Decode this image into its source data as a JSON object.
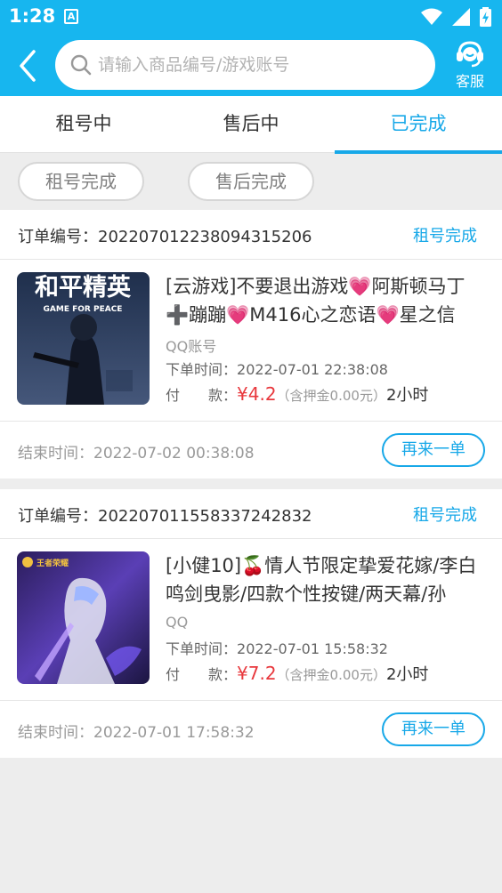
{
  "status_bar": {
    "time": "1:28",
    "app_icon_letter": "A",
    "icons": [
      "wifi-icon",
      "signal-icon",
      "battery-charging-icon"
    ]
  },
  "header": {
    "search_placeholder": "请输入商品编号/游戏账号",
    "service_label": "客服",
    "accent_color": "#17b6ef"
  },
  "tabs": [
    {
      "label": "租号中",
      "active": false
    },
    {
      "label": "售后中",
      "active": false
    },
    {
      "label": "已完成",
      "active": true
    }
  ],
  "filters": [
    {
      "label": "租号完成"
    },
    {
      "label": "售后完成"
    }
  ],
  "orders": [
    {
      "order_label": "订单编号：",
      "order_no": "2022070122380943152​06",
      "status": "租号完成",
      "game_logo_text": "和平精英",
      "game_logo_sub": "GAME FOR PEACE",
      "title": "[云游戏]不要退出游戏💗阿斯顿马丁➕蹦蹦💗M416心之恋语💗星之信",
      "account_type": "QQ账号",
      "order_time_label": "下单时间：",
      "order_time": "2022-07-01 22:38:08",
      "pay_label": "付　　款：",
      "price": "¥4.2",
      "deposit": "（含押金0.00元）",
      "duration": "2小时",
      "end_label": "结束时间：",
      "end_time": "2022-07-02 00:38:08",
      "again_label": "再来一单"
    },
    {
      "order_label": "订单编号：",
      "order_no": "202207011558337242832",
      "status": "租号完成",
      "game_logo_text": "王者荣耀",
      "game_logo_sub": "",
      "title": "[小健10]🍒情人节限定挚爱花嫁/李白鸣剑曳影/￼四款个性按键/两天幕/孙",
      "account_type": "QQ",
      "order_time_label": "下单时间：",
      "order_time": "2022-07-01 15:58:32",
      "pay_label": "付　　款：",
      "price": "¥7.2",
      "deposit": "（含押金0.00元）",
      "duration": "2小时",
      "end_label": "结束时间：",
      "end_time": "2022-07-01 17:58:32",
      "again_label": "再来一单"
    }
  ]
}
